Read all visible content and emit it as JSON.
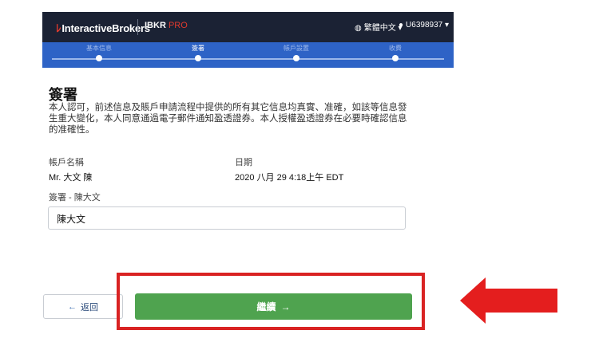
{
  "header": {
    "brand": "InteractiveBrokers",
    "product_main": "IBKR",
    "product_sub": " PRO",
    "language": "繁體中文",
    "username": "U6398937"
  },
  "steps": [
    {
      "label": "基本信息",
      "active": false
    },
    {
      "label": "簽署",
      "active": true
    },
    {
      "label": "帳戶設置",
      "active": false
    },
    {
      "label": "收費",
      "active": false
    }
  ],
  "content": {
    "title": "簽署",
    "description": "本人認可，前述信息及賬戶申請流程中提供的所有其它信息均真實、准確，如該等信息發生重大變化，本人同意通過電子郵件通知盈透證券。本人授權盈透證券在必要時確認信息的准確性。",
    "account_name_label": "帳戶名稱",
    "account_name_value": "Mr. 大文 陳",
    "date_label": "日期",
    "date_value": "2020 八月 29 4:18上午 EDT",
    "signature_label": "簽署 - 陳大文",
    "signature_value": "陳大文"
  },
  "buttons": {
    "back": "返回",
    "continue": "繼續"
  },
  "colors": {
    "header_bg": "#1b2234",
    "step_bar": "#2e63c6",
    "continue_green": "#4fa34f",
    "highlight_red": "#d92323",
    "brand_red": "#e03a2e"
  }
}
